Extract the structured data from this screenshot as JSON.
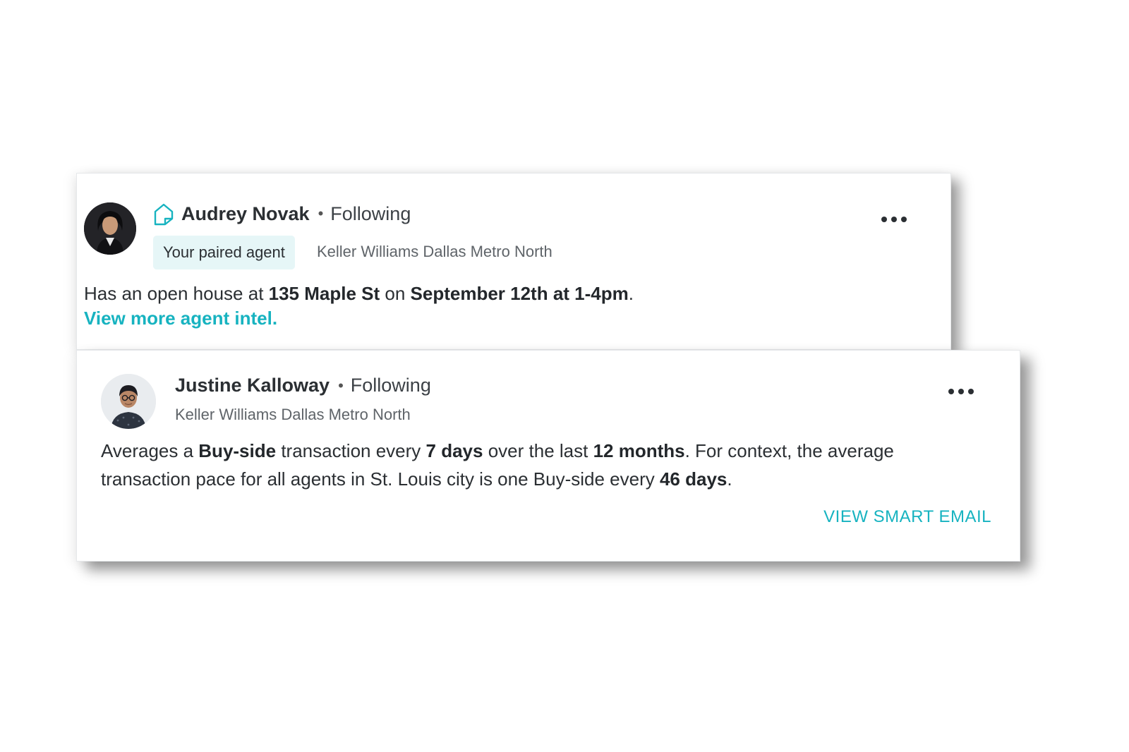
{
  "cards": [
    {
      "agent_name": "Audrey Novak",
      "separator": "•",
      "follow_status": "Following",
      "badge": "Your paired agent",
      "brokerage": "Keller Williams Dallas Metro North",
      "message": {
        "t1": "Has an open house at ",
        "b1": "135 Maple St",
        "t2": " on ",
        "b2": "September 12th at 1-4pm",
        "t3": "."
      },
      "link": "View more agent intel.",
      "icons": {
        "brand": "house-logo-icon",
        "more": "more-options-icon"
      }
    },
    {
      "agent_name": "Justine Kalloway",
      "separator": "•",
      "follow_status": "Following",
      "brokerage": "Keller Williams Dallas Metro North",
      "message": {
        "t1": "Averages a ",
        "b1": "Buy-side",
        "t2": " transaction every ",
        "b2": "7 days",
        "t3": " over the last ",
        "b3": "12 months",
        "t4": ". For context, the average transaction pace for all agents in St. Louis city is one Buy-side every ",
        "b4": "46 days",
        "t5": "."
      },
      "action": "VIEW SMART EMAIL",
      "icons": {
        "more": "more-options-icon"
      }
    }
  ],
  "colors": {
    "accent": "#17b3c0",
    "badge_bg": "#e6f6f7",
    "text": "#2b2f33",
    "muted": "#5f6469"
  }
}
